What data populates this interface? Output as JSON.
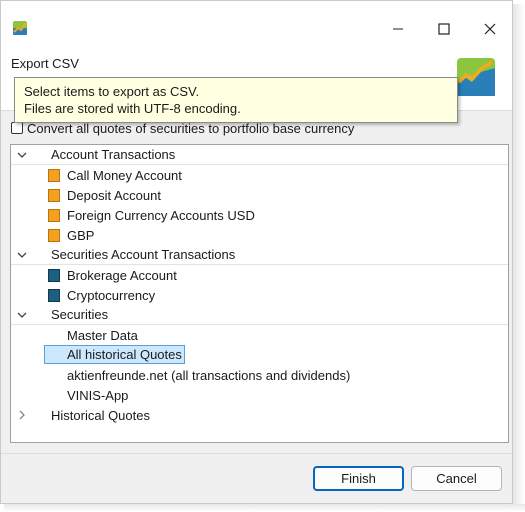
{
  "window": {
    "title": "",
    "controls": {
      "minimize": "minimize",
      "maximize": "maximize",
      "close": "close"
    }
  },
  "header": {
    "title": "Export CSV"
  },
  "tooltip": {
    "line1": "Select items to export as CSV.",
    "line2": "Files are stored with UTF-8 encoding."
  },
  "convert_option": {
    "label": "Convert all quotes of securities to portfolio base currency",
    "checked": false
  },
  "tree": {
    "groups": [
      {
        "label": "Account Transactions",
        "expanded": true,
        "items": [
          {
            "label": "Call Money Account",
            "icon": "account-icon"
          },
          {
            "label": "Deposit Account",
            "icon": "account-icon"
          },
          {
            "label": "Foreign Currency Accounts USD",
            "icon": "account-icon"
          },
          {
            "label": "GBP",
            "icon": "account-icon"
          }
        ]
      },
      {
        "label": "Securities Account Transactions",
        "expanded": true,
        "items": [
          {
            "label": "Brokerage Account",
            "icon": "portfolio-icon"
          },
          {
            "label": "Cryptocurrency",
            "icon": "portfolio-icon"
          }
        ]
      },
      {
        "label": "Securities",
        "expanded": true,
        "items": [
          {
            "label": "Master Data"
          },
          {
            "label": "All historical Quotes",
            "selected": true
          },
          {
            "label": "aktienfreunde.net (all transactions and dividends)"
          },
          {
            "label": "VINIS-App"
          }
        ]
      },
      {
        "label": "Historical Quotes",
        "expanded": false,
        "items": []
      }
    ]
  },
  "footer": {
    "finish_label": "Finish",
    "cancel_label": "Cancel"
  },
  "colors": {
    "account_icon": "#f4a020",
    "portfolio_icon": "#1d5f80",
    "selection": "#cce8ff",
    "default_button_border": "#0067c0",
    "tooltip_bg": "#ffffe1"
  }
}
